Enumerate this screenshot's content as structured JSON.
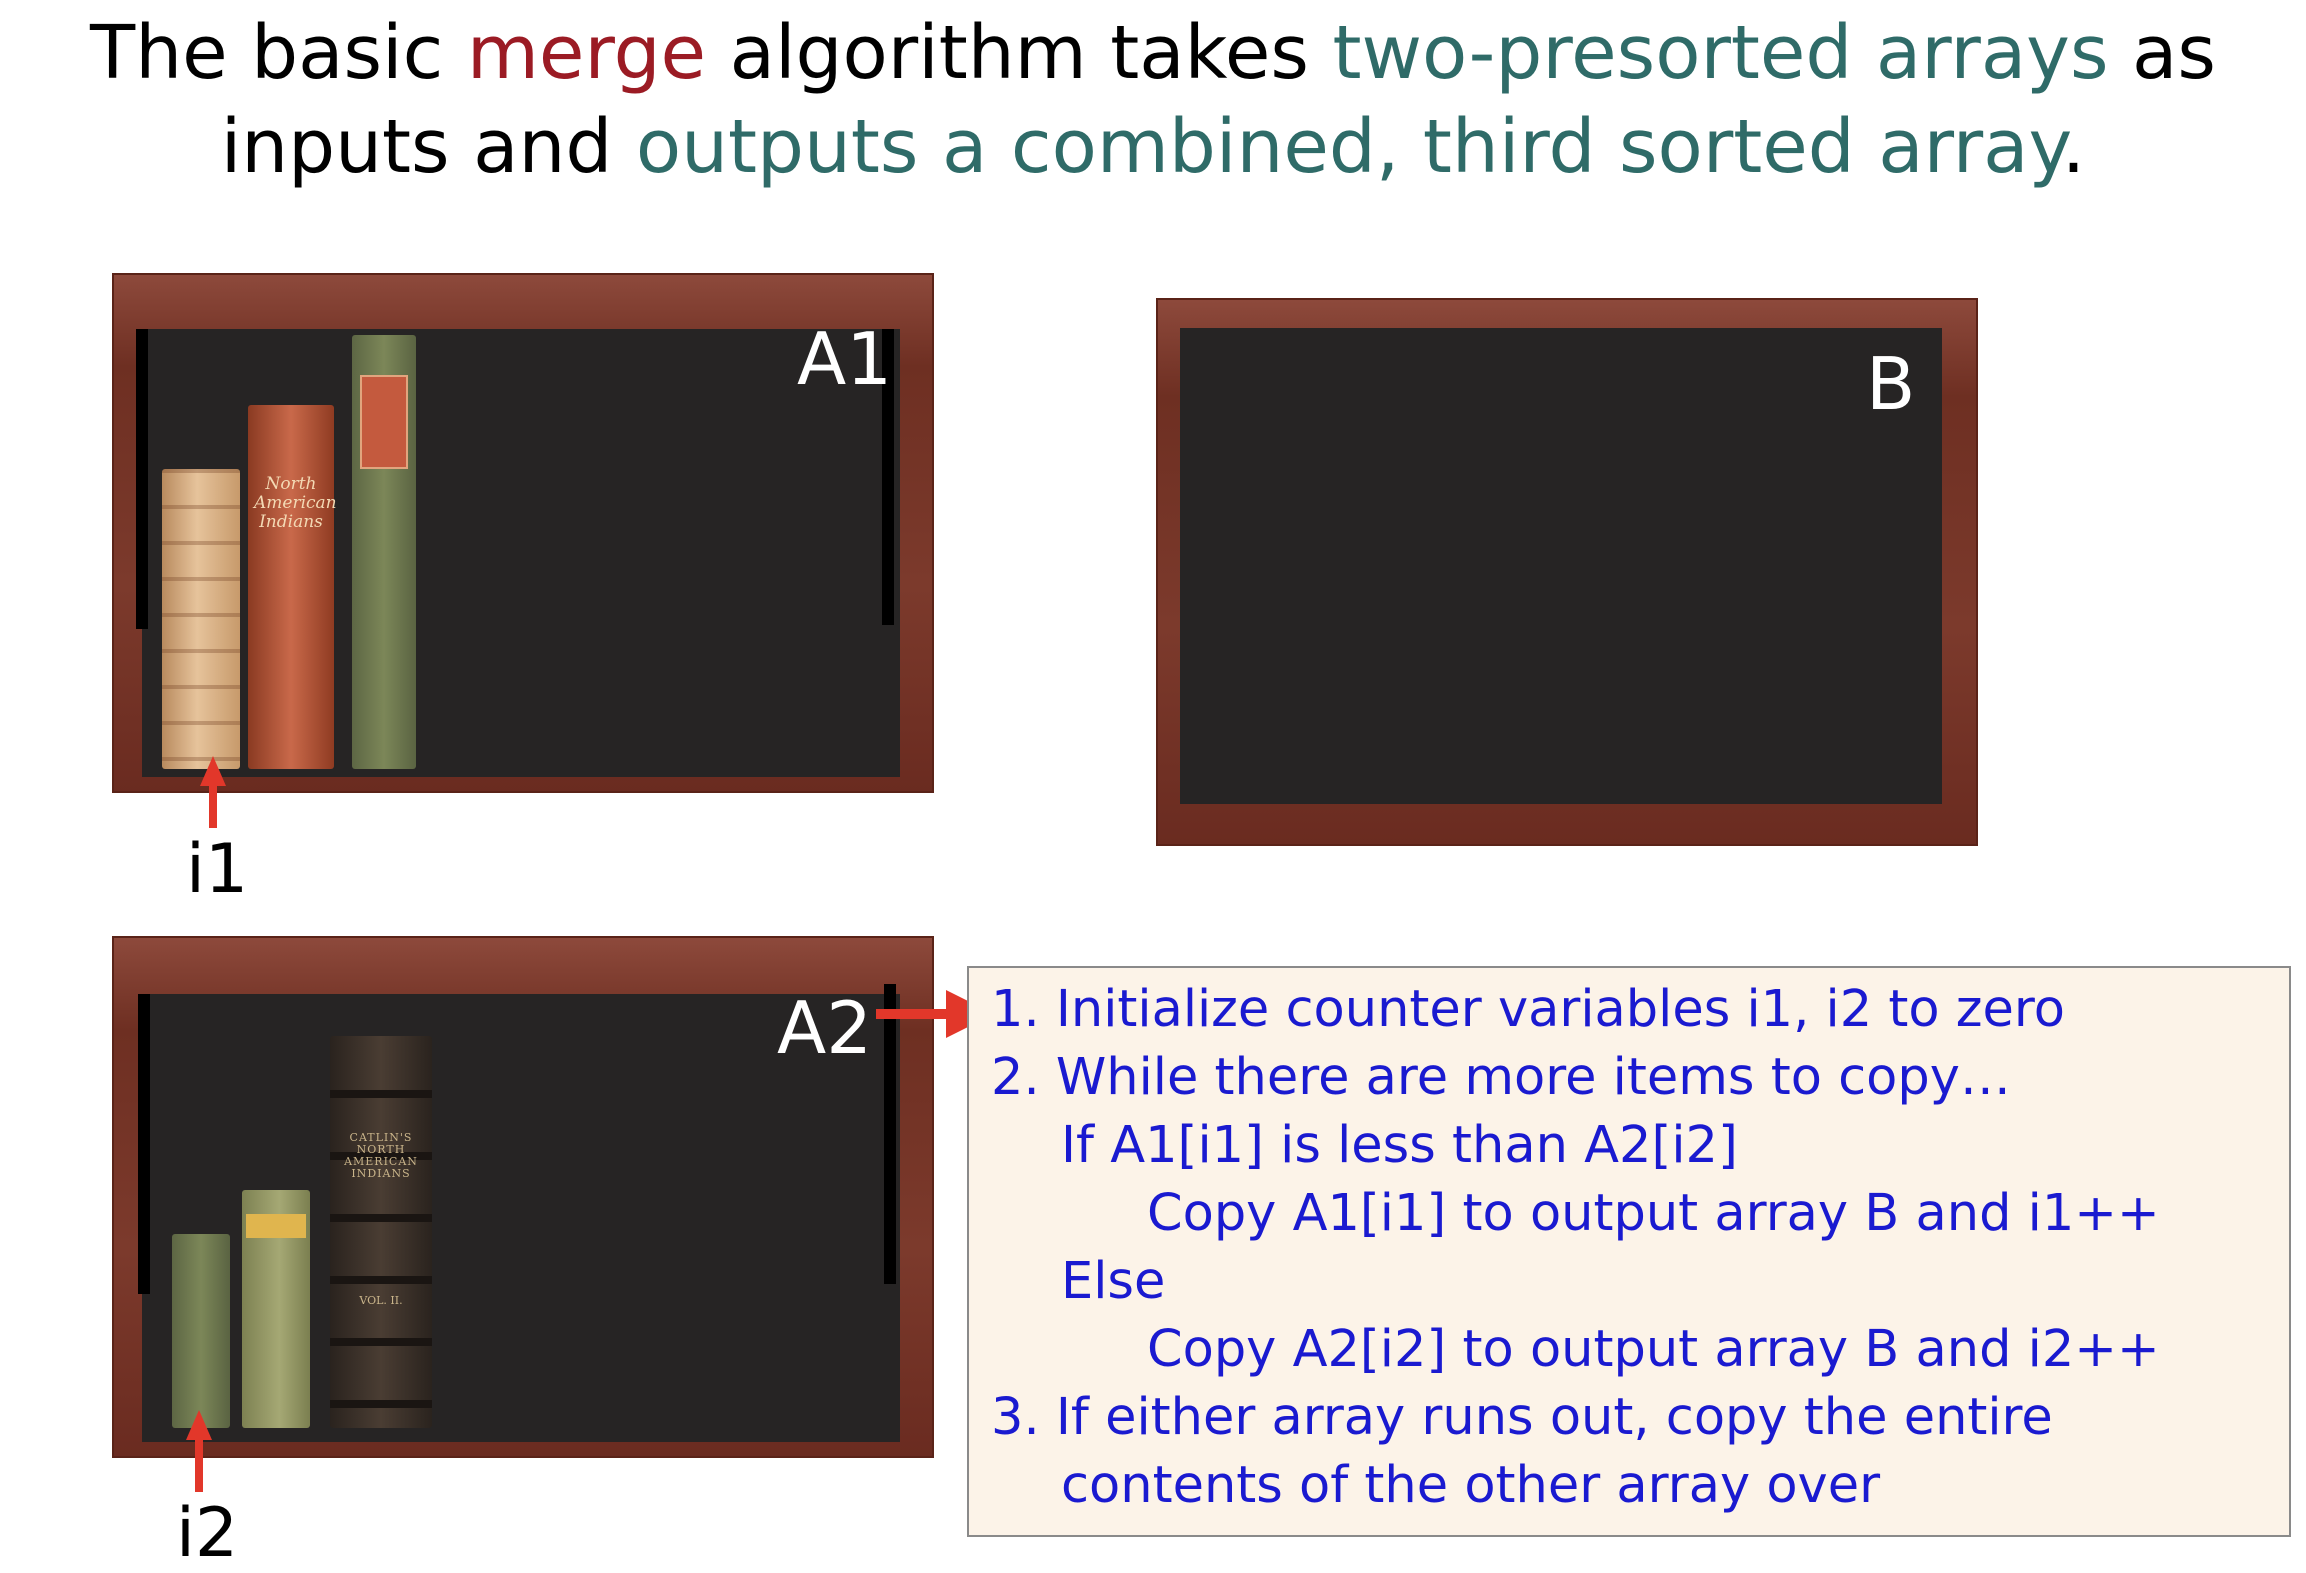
{
  "title": {
    "line1": {
      "part1": "The basic ",
      "part2": "merge",
      "part3": " algorithm takes ",
      "part4": "two-presorted arrays",
      "part5": " as"
    },
    "line2": {
      "part1": "inputs and ",
      "part2": "outputs a combined, third sorted array",
      "part3": "."
    }
  },
  "colors": {
    "highlight_red": "#9b1b24",
    "highlight_teal": "#2f6b68",
    "algorithm_text": "#1a1ad0",
    "pointer_arrow": "#e2372a"
  },
  "shelves": {
    "a1": {
      "label": "A1"
    },
    "b": {
      "label": "B"
    },
    "a2": {
      "label": "A2"
    }
  },
  "books": {
    "a1_red_spine": "North American Indians",
    "a2_dark_spine": "CATLIN'S NORTH AMERICAN INDIANS",
    "a2_dark_volume": "VOL. II."
  },
  "pointers": {
    "i1": "i1",
    "i2": "i2"
  },
  "algorithm": {
    "lines": [
      "1. Initialize counter variables i1, i2 to zero",
      "2. While there are more items to copy…",
      "If A1[i1] is less than A2[i2]",
      "Copy A1[i1] to output array B and i1++",
      "Else",
      "Copy A2[i2] to output array B and i2++",
      "3. If either array runs out, copy the entire",
      "contents of the other array over"
    ]
  }
}
